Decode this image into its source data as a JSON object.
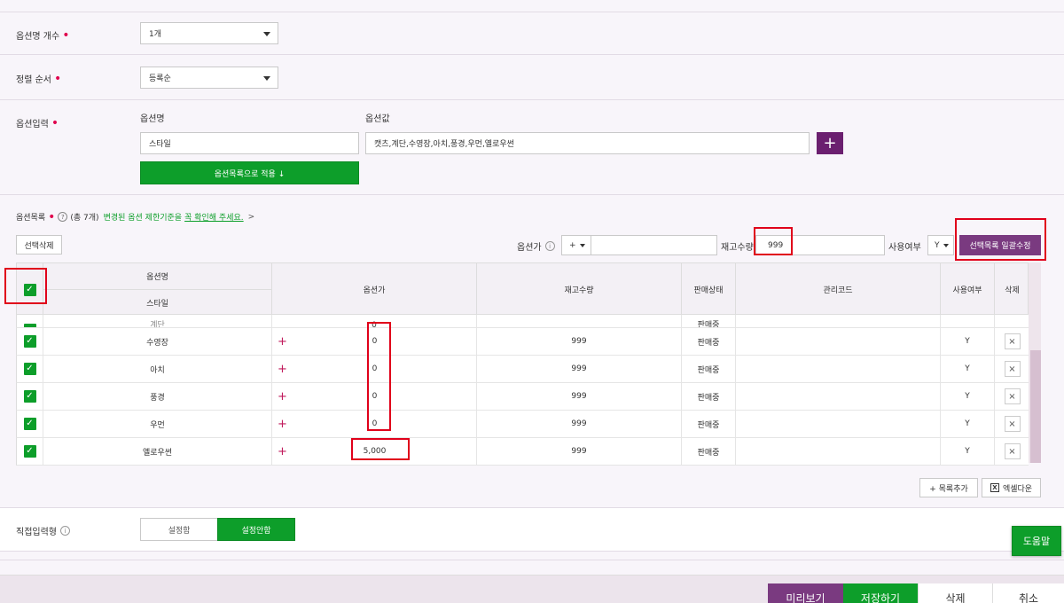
{
  "option_count": {
    "label": "옵션명 개수",
    "value": "1개"
  },
  "sort_order": {
    "label": "정렬 순서",
    "value": "등록순"
  },
  "option_input": {
    "label": "옵션입력",
    "name_header": "옵션명",
    "value_header": "옵션값",
    "name_value": "스타일",
    "values_value": "캣츠,계단,수영장,아치,풍경,우먼,옐로우썬",
    "apply_button": "옵션목록으로 적용 ↓",
    "add_symbol": "+"
  },
  "option_list": {
    "label": "옵션목록",
    "help_symbol": "?",
    "count_text": "(총 7개)",
    "notice_prefix": "변경된 옵션 제한기준을",
    "notice_link": "꼭 확인해 주세요.",
    "notice_suffix": ">",
    "delete_selected": "선택삭제",
    "price_label": "옵션가",
    "info_symbol": "i",
    "price_sign": "+",
    "stock_label": "재고수량",
    "stock_value": "999",
    "use_label": "사용여부",
    "use_value": "Y",
    "bulk_edit": "선택목록 일괄수정"
  },
  "table": {
    "headers": {
      "option_name": "옵션명",
      "option_name_sub": "스타일",
      "price": "옵션가",
      "stock": "재고수량",
      "status": "판매상태",
      "code": "관리코드",
      "use": "사용여부",
      "delete": "삭제"
    },
    "partial_row": {
      "name": "계단",
      "price": "0",
      "status": "판매중"
    },
    "rows": [
      {
        "name": "수영장",
        "price": "0",
        "stock": "999",
        "status": "판매중",
        "use": "Y"
      },
      {
        "name": "아치",
        "price": "0",
        "stock": "999",
        "status": "판매중",
        "use": "Y"
      },
      {
        "name": "풍경",
        "price": "0",
        "stock": "999",
        "status": "판매중",
        "use": "Y"
      },
      {
        "name": "우먼",
        "price": "0",
        "stock": "999",
        "status": "판매중",
        "use": "Y"
      },
      {
        "name": "옐로우썬",
        "price": "5,000",
        "stock": "999",
        "status": "판매중",
        "use": "Y"
      }
    ],
    "plus_symbol": "+",
    "delete_symbol": "×",
    "check_symbol": "✓"
  },
  "list_actions": {
    "add_row": "+ 목록추가",
    "excel_icon_text": "X",
    "excel_download": "엑셀다운"
  },
  "direct_input": {
    "label": "직접입력형",
    "info_symbol": "i",
    "option_on": "설정함",
    "option_off": "설정안함"
  },
  "help_button": "도움말",
  "bottom": {
    "preview": "미리보기",
    "save": "저장하기",
    "delete": "삭제",
    "cancel": "취소"
  },
  "colors": {
    "green": "#0d9e2a",
    "purple": "#6b1f6f",
    "red_highlight": "#e0001a",
    "required_dot": "#e0004d"
  }
}
